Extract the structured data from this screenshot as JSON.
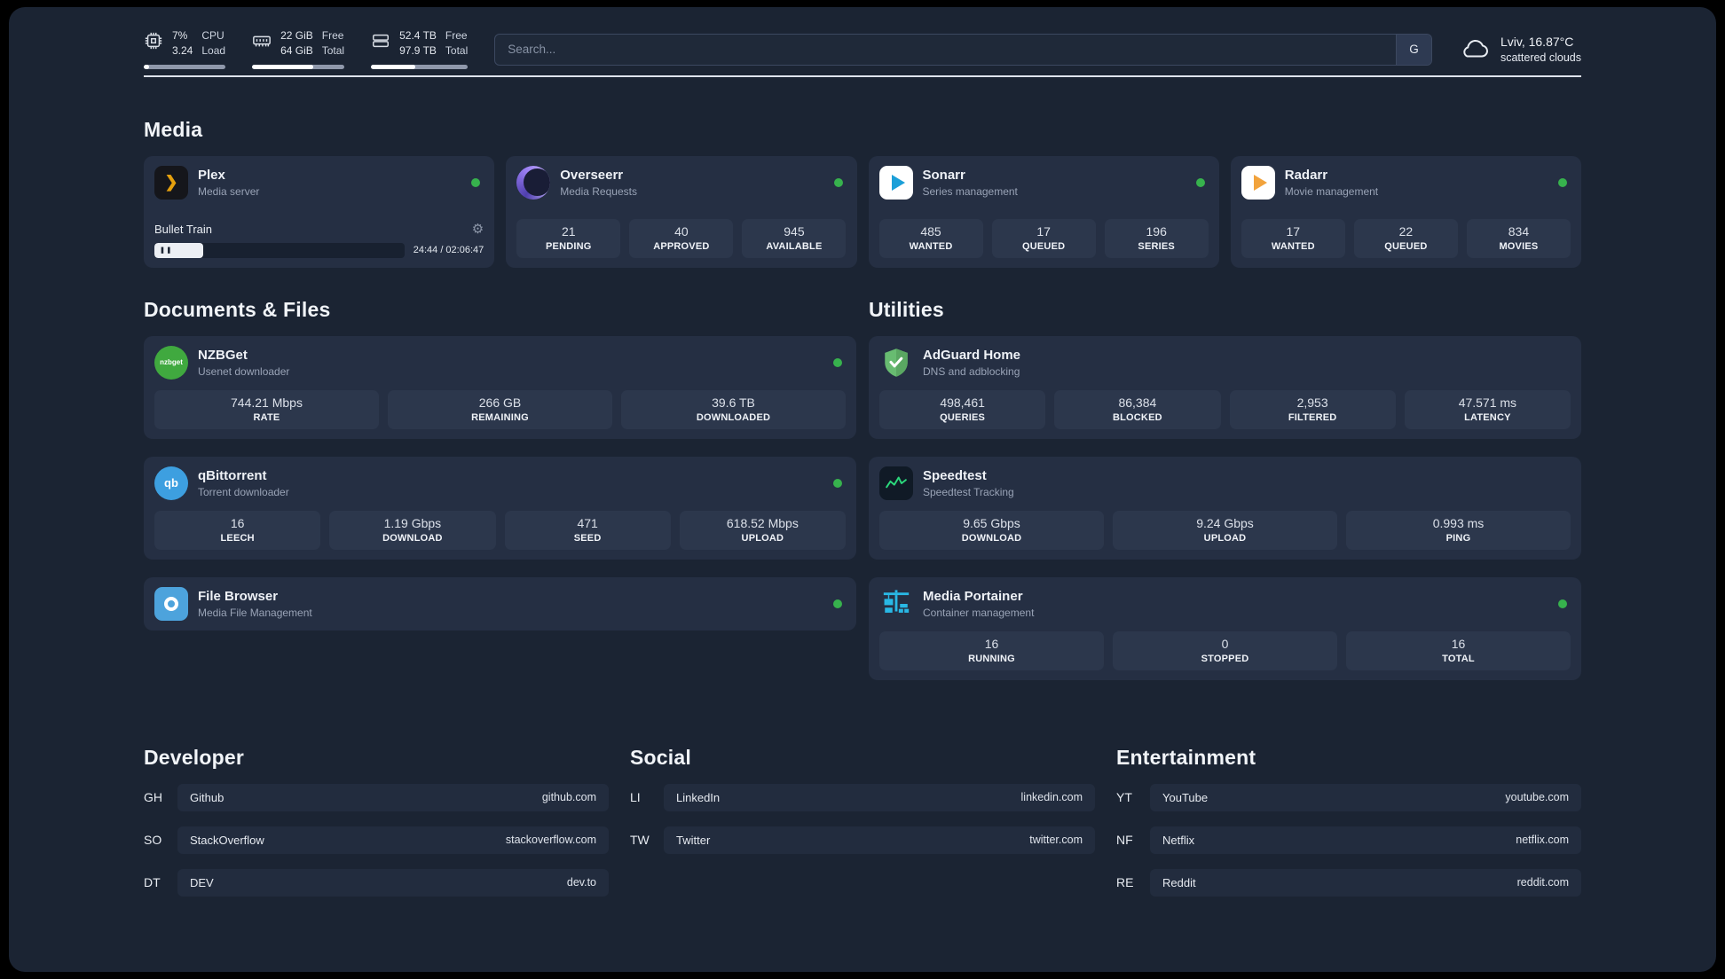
{
  "topbar": {
    "cpu": {
      "line1": "7%",
      "line2": "3.24",
      "label1": "CPU",
      "label2": "Load",
      "progress": 7
    },
    "ram": {
      "line1": "22 GiB",
      "line2": "64 GiB",
      "label1": "Free",
      "label2": "Total",
      "progress": 66
    },
    "disk": {
      "line1": "52.4 TB",
      "line2": "97.9 TB",
      "label1": "Free",
      "label2": "Total",
      "progress": 46
    },
    "search": {
      "placeholder": "Search...",
      "button": "G"
    },
    "weather": {
      "location": "Lviv, 16.87°C",
      "condition": "scattered clouds"
    }
  },
  "media": {
    "title": "Media",
    "plex": {
      "name": "Plex",
      "subtitle": "Media server",
      "now_playing": {
        "title": "Bullet Train",
        "time": "24:44 / 02:06:47",
        "progress": 19.5
      }
    },
    "overseerr": {
      "name": "Overseerr",
      "subtitle": "Media Requests",
      "stats": [
        {
          "value": "21",
          "label": "PENDING"
        },
        {
          "value": "40",
          "label": "APPROVED"
        },
        {
          "value": "945",
          "label": "AVAILABLE"
        }
      ]
    },
    "sonarr": {
      "name": "Sonarr",
      "subtitle": "Series management",
      "stats": [
        {
          "value": "485",
          "label": "WANTED"
        },
        {
          "value": "17",
          "label": "QUEUED"
        },
        {
          "value": "196",
          "label": "SERIES"
        }
      ]
    },
    "radarr": {
      "name": "Radarr",
      "subtitle": "Movie management",
      "stats": [
        {
          "value": "17",
          "label": "WANTED"
        },
        {
          "value": "22",
          "label": "QUEUED"
        },
        {
          "value": "834",
          "label": "MOVIES"
        }
      ]
    }
  },
  "documents": {
    "title": "Documents & Files",
    "nzbget": {
      "name": "NZBGet",
      "subtitle": "Usenet downloader",
      "stats": [
        {
          "value": "744.21 Mbps",
          "label": "RATE"
        },
        {
          "value": "266 GB",
          "label": "REMAINING"
        },
        {
          "value": "39.6 TB",
          "label": "DOWNLOADED"
        }
      ]
    },
    "qbittorrent": {
      "name": "qBittorrent",
      "subtitle": "Torrent downloader",
      "stats": [
        {
          "value": "16",
          "label": "LEECH"
        },
        {
          "value": "1.19 Gbps",
          "label": "DOWNLOAD"
        },
        {
          "value": "471",
          "label": "SEED"
        },
        {
          "value": "618.52 Mbps",
          "label": "UPLOAD"
        }
      ]
    },
    "filebrowser": {
      "name": "File Browser",
      "subtitle": "Media File Management"
    }
  },
  "utilities": {
    "title": "Utilities",
    "adguard": {
      "name": "AdGuard Home",
      "subtitle": "DNS and adblocking",
      "stats": [
        {
          "value": "498,461",
          "label": "QUERIES"
        },
        {
          "value": "86,384",
          "label": "BLOCKED"
        },
        {
          "value": "2,953",
          "label": "FILTERED"
        },
        {
          "value": "47.571 ms",
          "label": "LATENCY"
        }
      ]
    },
    "speedtest": {
      "name": "Speedtest",
      "subtitle": "Speedtest Tracking",
      "stats": [
        {
          "value": "9.65 Gbps",
          "label": "DOWNLOAD"
        },
        {
          "value": "9.24 Gbps",
          "label": "UPLOAD"
        },
        {
          "value": "0.993 ms",
          "label": "PING"
        }
      ]
    },
    "portainer": {
      "name": "Media Portainer",
      "subtitle": "Container management",
      "stats": [
        {
          "value": "16",
          "label": "RUNNING"
        },
        {
          "value": "0",
          "label": "STOPPED"
        },
        {
          "value": "16",
          "label": "TOTAL"
        }
      ]
    }
  },
  "bookmarks": {
    "developer": {
      "title": "Developer",
      "items": [
        {
          "abbr": "GH",
          "name": "Github",
          "url": "github.com"
        },
        {
          "abbr": "SO",
          "name": "StackOverflow",
          "url": "stackoverflow.com"
        },
        {
          "abbr": "DT",
          "name": "DEV",
          "url": "dev.to"
        }
      ]
    },
    "social": {
      "title": "Social",
      "items": [
        {
          "abbr": "LI",
          "name": "LinkedIn",
          "url": "linkedin.com"
        },
        {
          "abbr": "TW",
          "name": "Twitter",
          "url": "twitter.com"
        }
      ]
    },
    "entertainment": {
      "title": "Entertainment",
      "items": [
        {
          "abbr": "YT",
          "name": "YouTube",
          "url": "youtube.com"
        },
        {
          "abbr": "NF",
          "name": "Netflix",
          "url": "netflix.com"
        },
        {
          "abbr": "RE",
          "name": "Reddit",
          "url": "reddit.com"
        }
      ]
    }
  },
  "icons": {
    "plex_glyph": "❯",
    "gear": "⚙",
    "pause": "❚❚",
    "nzbget_label": "nzbget",
    "qbittorrent_label": "qb"
  },
  "colors": {
    "status_online": "#37b24d",
    "plex_accent": "#e5a00d",
    "sonarr_blue": "#1b9fd8",
    "radarr_amber": "#f2a33c",
    "adguard_green": "#68bc71",
    "speedtest_green": "#2bd97c",
    "portainer_blue": "#29b8e5"
  }
}
